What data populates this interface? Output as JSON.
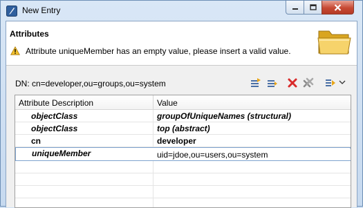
{
  "window": {
    "title": "New Entry",
    "controls": {
      "minimize": "minimize-icon",
      "maximize": "maximize-icon",
      "close": "close-icon"
    }
  },
  "header": {
    "title": "Attributes",
    "message": "Attribute uniqueMember has an empty value, please insert a valid value.",
    "message_icon": "warning-icon",
    "banner_icon": "folder-icon"
  },
  "dn": {
    "label": "DN: cn=developer,ou=groups,ou=system"
  },
  "toolbar": {
    "icons": [
      "new-attribute-icon",
      "new-value-icon",
      "delete-icon",
      "delete-all-icon",
      "expand-icon",
      "view-menu-icon"
    ]
  },
  "table": {
    "columns": [
      "Attribute Description",
      "Value"
    ],
    "rows": [
      {
        "attribute": "objectClass",
        "value": "groupOfUniqueNames (structural)"
      },
      {
        "attribute": "objectClass",
        "value": "top (abstract)"
      },
      {
        "attribute": "cn",
        "value": "developer"
      },
      {
        "attribute": "uniqueMember",
        "value": "uid=jdoe,ou=users,ou=system"
      }
    ]
  },
  "colors": {
    "selection_border": "#7da2ce",
    "close_button": "#c74a34",
    "delete_icon": "#d92b2b",
    "warning": "#f2c12e"
  }
}
